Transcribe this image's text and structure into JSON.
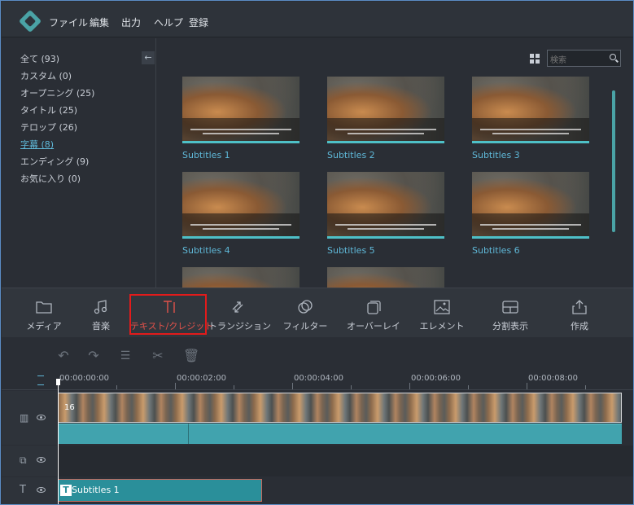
{
  "menu": {
    "items": [
      "ファイル",
      "編集",
      "出力",
      "ヘルプ",
      "登録"
    ]
  },
  "categories": [
    {
      "label": "全て (93)"
    },
    {
      "label": "カスタム (0)"
    },
    {
      "label": "オープニング (25)"
    },
    {
      "label": "タイトル (25)"
    },
    {
      "label": "テロップ (26)"
    },
    {
      "label": "字幕 (8)",
      "active": true
    },
    {
      "label": "エンディング (9)"
    },
    {
      "label": "お気に入り (0)"
    }
  ],
  "search": {
    "placeholder": "検索"
  },
  "thumbnails": [
    {
      "label": "Subtitles 1"
    },
    {
      "label": "Subtitles 2"
    },
    {
      "label": "Subtitles 3"
    },
    {
      "label": "Subtitles 4"
    },
    {
      "label": "Subtitles 5"
    },
    {
      "label": "Subtitles 6"
    }
  ],
  "toolbar": {
    "items": [
      {
        "label": "メディア",
        "icon": "folder-icon"
      },
      {
        "label": "音楽",
        "icon": "music-note-icon"
      },
      {
        "label": "テキスト/クレジット",
        "icon": "text-icon",
        "selected": true
      },
      {
        "label": "トランジション",
        "icon": "transition-icon"
      },
      {
        "label": "フィルター",
        "icon": "filter-icon"
      },
      {
        "label": "オーバーレイ",
        "icon": "overlay-icon"
      },
      {
        "label": "エレメント",
        "icon": "element-icon"
      },
      {
        "label": "分割表示",
        "icon": "split-screen-icon"
      },
      {
        "label": "作成",
        "icon": "export-icon"
      }
    ]
  },
  "timeline": {
    "ruler": [
      "00:00:00:00",
      "00:00:02:00",
      "00:00:04:00",
      "00:00:06:00",
      "00:00:08:00"
    ],
    "video_clip_number": "16",
    "subtitle_clip": "Subtitles 1"
  },
  "colors": {
    "accent": "#4ec0c7",
    "selected_text": "#e2524a",
    "highlight_box": "#e21b1b"
  }
}
